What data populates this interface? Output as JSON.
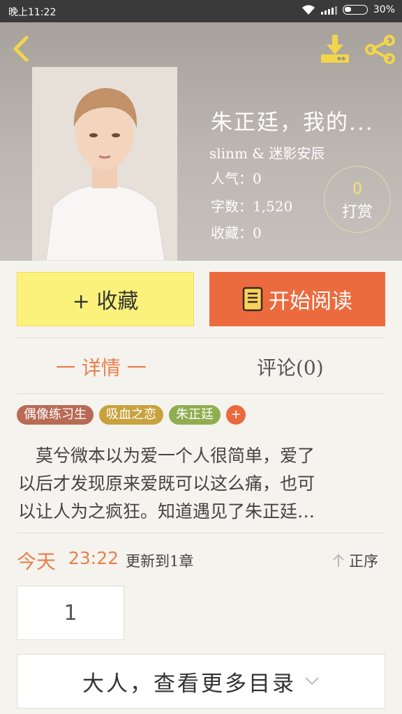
{
  "status_bar": {
    "time": "晚上11:22",
    "battery": "30%"
  },
  "book": {
    "title": "朱正廷，我的...",
    "author": "slinm & 迷影安辰",
    "stats": [
      {
        "label": "人气：",
        "value": "0"
      },
      {
        "label": "字数：",
        "value": "1,520"
      },
      {
        "label": "收藏：",
        "value": "0"
      }
    ],
    "tip": {
      "count": "0",
      "label": "打赏"
    }
  },
  "actions": {
    "favorite": "+ 收藏",
    "read": "开始阅读"
  },
  "tabs": {
    "detail": "一 详情 一",
    "comments": "评论(0)"
  },
  "tags": [
    {
      "label": "偶像练习生",
      "color": "#b86a55"
    },
    {
      "label": "吸血之恋",
      "color": "#c9a23e"
    },
    {
      "label": "朱正廷",
      "color": "#8fae4f"
    }
  ],
  "tag_more": "+",
  "description": [
    "　莫兮微本以为爱一个人很简单，爱了",
    "以后才发现原来爱既可以这么痛，也可",
    "以让人为之疯狂。知道遇见了朱正廷…"
  ],
  "update": {
    "day": "今天",
    "time": "23:22",
    "text": "更新到1章",
    "sort": "正序"
  },
  "chapter_number": "1",
  "more_catalog": "大人，查看更多目录",
  "colors": {
    "accent": "#ec6b3e",
    "favorite_bg": "#faf27a",
    "header_bg": "#b3ada8",
    "text_accent": "#e8804e"
  }
}
